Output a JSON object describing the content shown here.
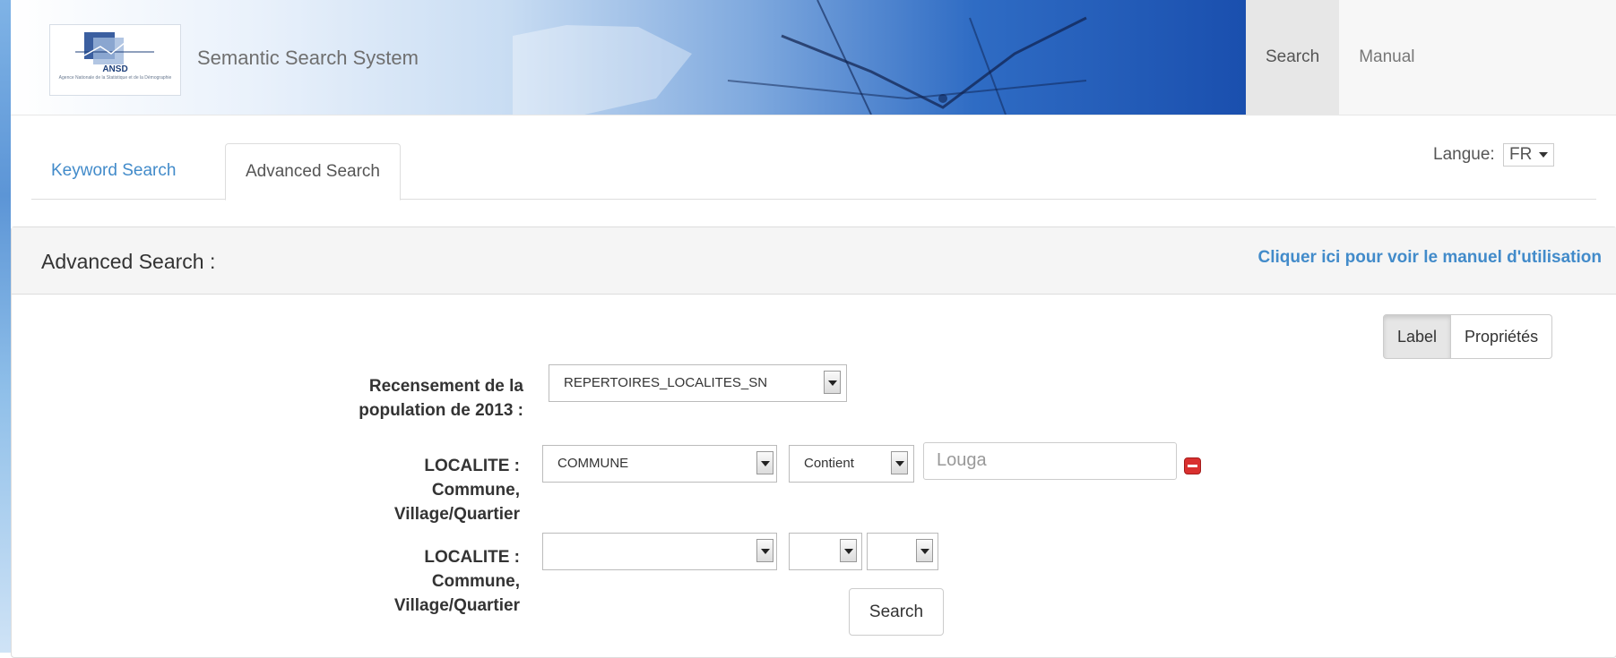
{
  "header": {
    "brand": "Semantic Search System",
    "logo_text": "ANSD",
    "logo_subtext": "Agence Nationale de la Statistique et de la Démographie",
    "nav": [
      {
        "label": "Search",
        "active": true
      },
      {
        "label": "Manual",
        "active": false
      }
    ]
  },
  "tabs": [
    {
      "label": "Keyword Search",
      "active": false
    },
    {
      "label": "Advanced Search",
      "active": true
    }
  ],
  "language": {
    "label": "Langue:",
    "value": "FR"
  },
  "panel": {
    "title": "Advanced Search :",
    "manual_link": "Cliquer ici pour voir le manuel d'utilisation"
  },
  "view_toggle": [
    {
      "label": "Label",
      "selected": true
    },
    {
      "label": "Propriétés",
      "selected": false
    }
  ],
  "form": {
    "dataset_label_1": "Recensement de la",
    "dataset_label_2": "population de 2013 :",
    "dataset_value": "REPERTOIRES_LOCALITES_SN",
    "rows": [
      {
        "label_1": "LOCALITE :",
        "label_2": "Commune,",
        "label_3": "Village/Quartier",
        "property": "COMMUNE",
        "operator": "Contient",
        "value": "Louga"
      },
      {
        "label_1": "LOCALITE :",
        "label_2": "Commune,",
        "label_3": "Village/Quartier",
        "property": "",
        "operator": "",
        "extra": ""
      }
    ],
    "search_button": "Search"
  },
  "colors": {
    "link": "#428bca",
    "remove_icon": "#d9302f",
    "banner_blue": "#1a4fae"
  }
}
